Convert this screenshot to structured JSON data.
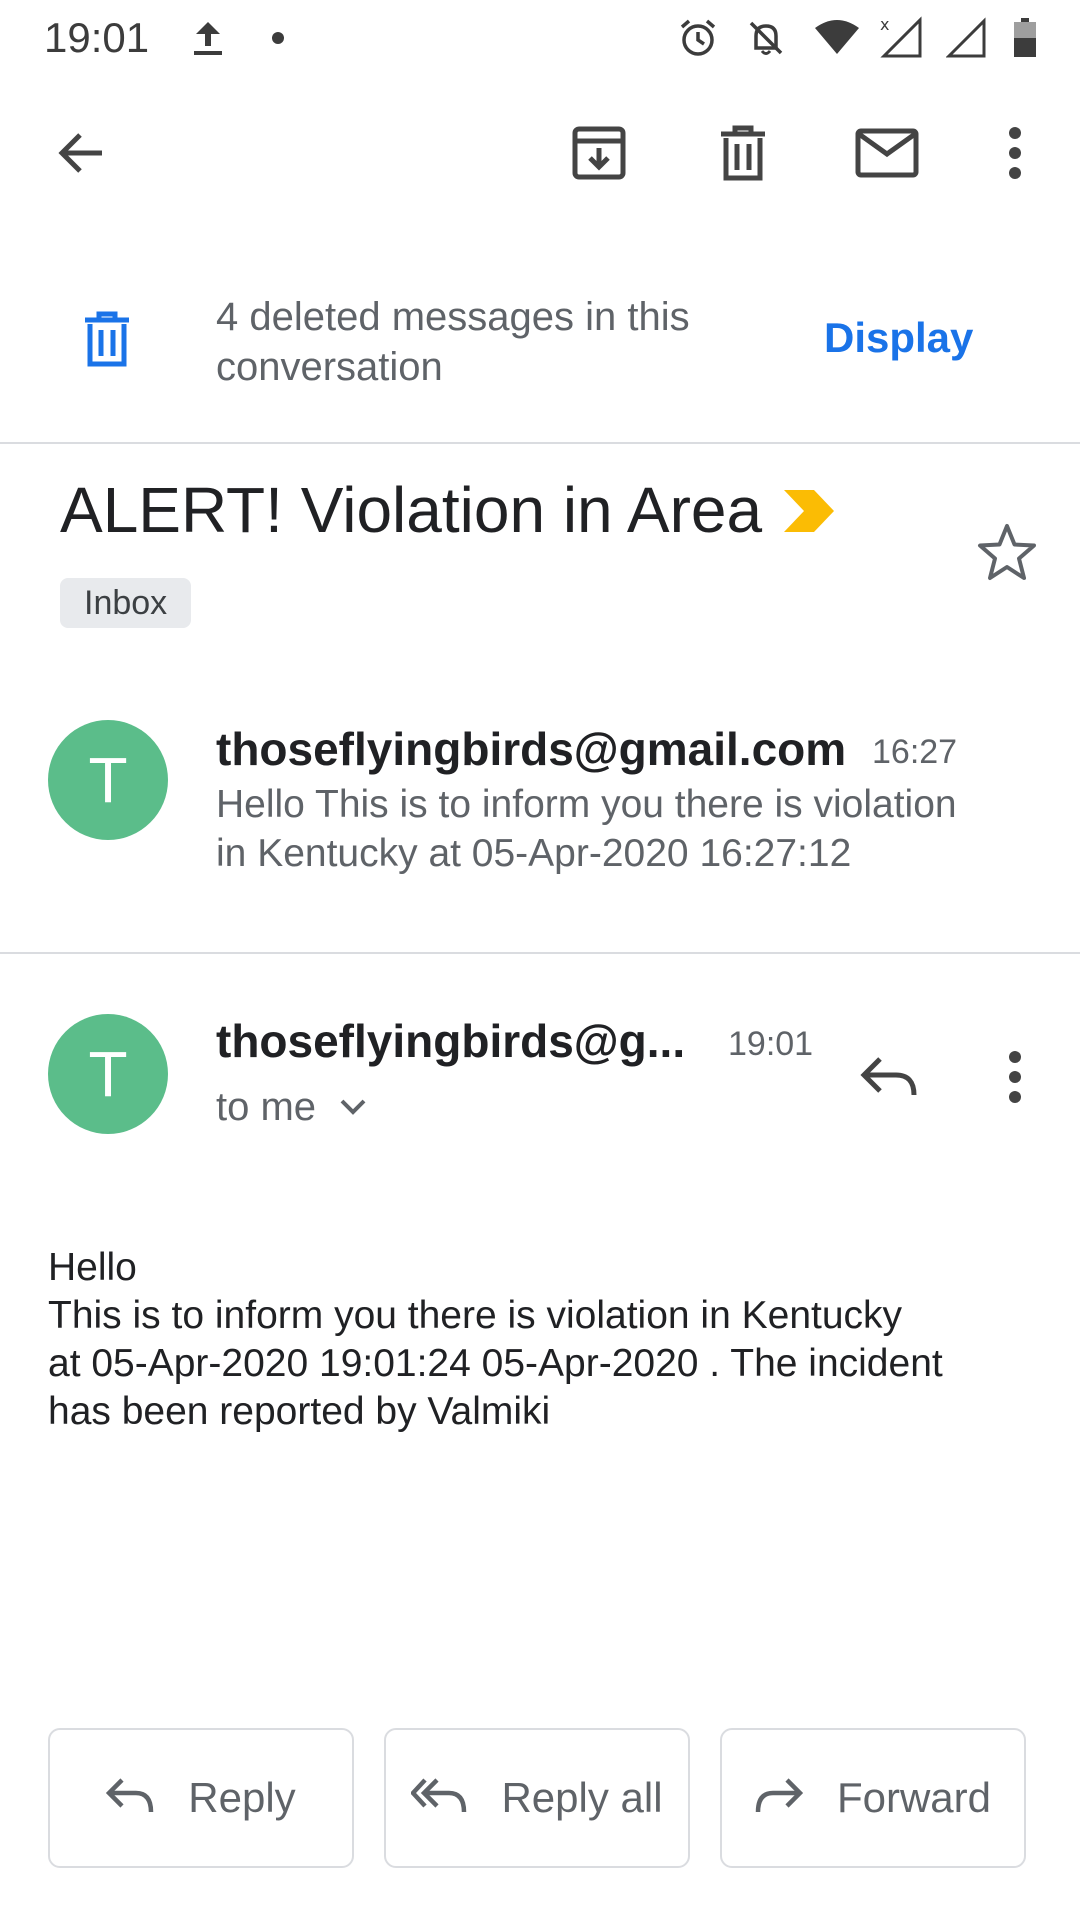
{
  "status_bar": {
    "time": "19:01",
    "icons": [
      "upload-icon",
      "dot-icon",
      "alarm-icon",
      "notifications-off-icon",
      "wifi-icon",
      "signal-icon",
      "signal-icon",
      "battery-icon"
    ]
  },
  "toolbar": {
    "back": "back-arrow-icon",
    "archive": "archive-icon",
    "delete": "delete-icon",
    "mark_unread": "mail-icon",
    "more": "more-vert-icon"
  },
  "deleted_banner": {
    "text": "4 deleted messages in this conversation",
    "action": "Display",
    "accent_color": "#1a73e8"
  },
  "subject": {
    "title": "ALERT! Violation in Area",
    "label_chip": "Inbox",
    "importance_color": "#fbbc04"
  },
  "messages": [
    {
      "avatar_letter": "T",
      "sender": "thoseflyingbirds@gmail.com",
      "time": "16:27",
      "snippet_lines": [
        "Hello This is to inform you there is violation",
        "in Kentucky at 05-Apr-2020 16:27:12"
      ]
    },
    {
      "avatar_letter": "T",
      "sender": "thoseflyingbirds@g...",
      "time": "19:01",
      "recipient": "to me",
      "body_lines": [
        "Hello",
        "This is to inform you there is violation in Kentucky",
        "at 05-Apr-2020 19:01:24 05-Apr-2020 . The incident",
        "has been reported by Valmiki"
      ]
    }
  ],
  "actions": {
    "reply": "Reply",
    "reply_all": "Reply all",
    "forward": "Forward"
  },
  "colors": {
    "avatar": "#5bbd8a",
    "divider": "#dadce0"
  }
}
